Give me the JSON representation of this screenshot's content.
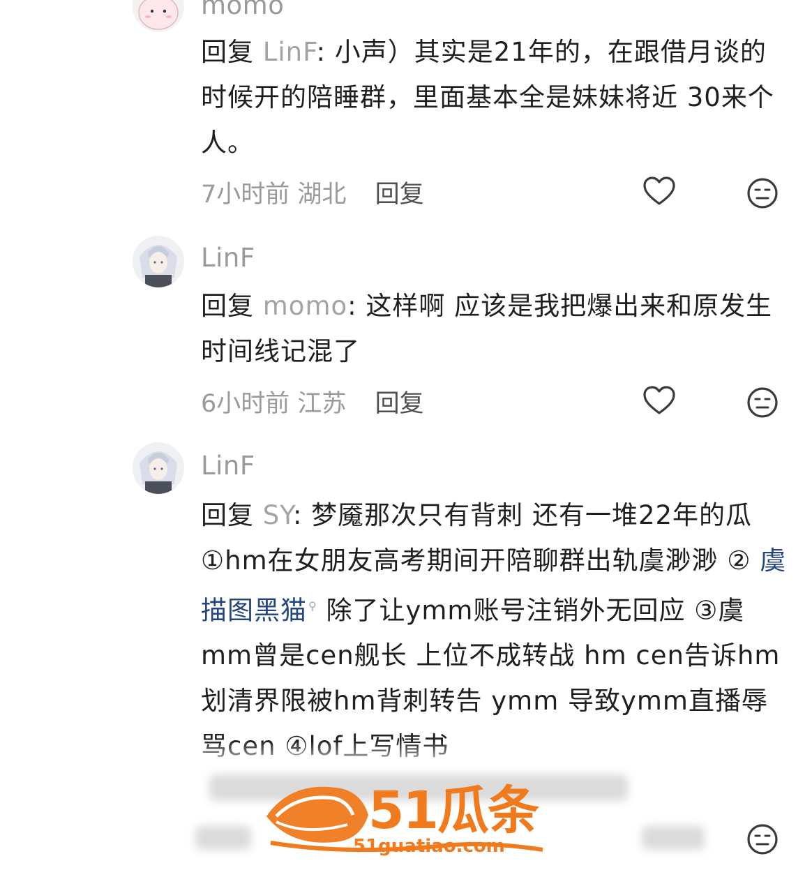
{
  "comments": [
    {
      "username": "momo",
      "reply_prefix": "回复 ",
      "reply_to": "LinF",
      "text": ": 小声）其实是21年的，在跟借月谈的时候开的陪睡群，里面基本全是妹妹将近 30来个人。",
      "time": "7小时前",
      "location": "湖北",
      "reply_label": "回复"
    },
    {
      "username": "LinF",
      "reply_prefix": "回复 ",
      "reply_to": "momo",
      "text": ": 这样啊 应该是我把爆出来和原发生时间线记混了",
      "time": "6小时前",
      "location": "江苏",
      "reply_label": "回复"
    },
    {
      "username": "LinF",
      "reply_prefix": "回复 ",
      "reply_to": "SY",
      "text_before_link": ": 梦魇那次只有背刺 还有一堆22年的瓜 ①hm在女朋友高考期间开陪聊群出轨虞渺渺 ② ",
      "link_text": "虞描图黑猫",
      "text_after_link": " 除了让ymm账号注销外无回应 ③虞mm曾是cen舰长 上位不成转战 hm cen告诉hm划清界限被hm背刺转告 ymm 导致ymm直播辱骂cen ④lof上写情书"
    }
  ],
  "watermark": {
    "brand": "51瓜条",
    "domain": "51guatiao.com"
  },
  "colors": {
    "accent_orange": "#f07a1c",
    "link_blue": "#24457d",
    "muted_gray": "#9a9a9a"
  },
  "icons": [
    "heart-outline-icon",
    "neutral-face-icon",
    "search-icon"
  ]
}
